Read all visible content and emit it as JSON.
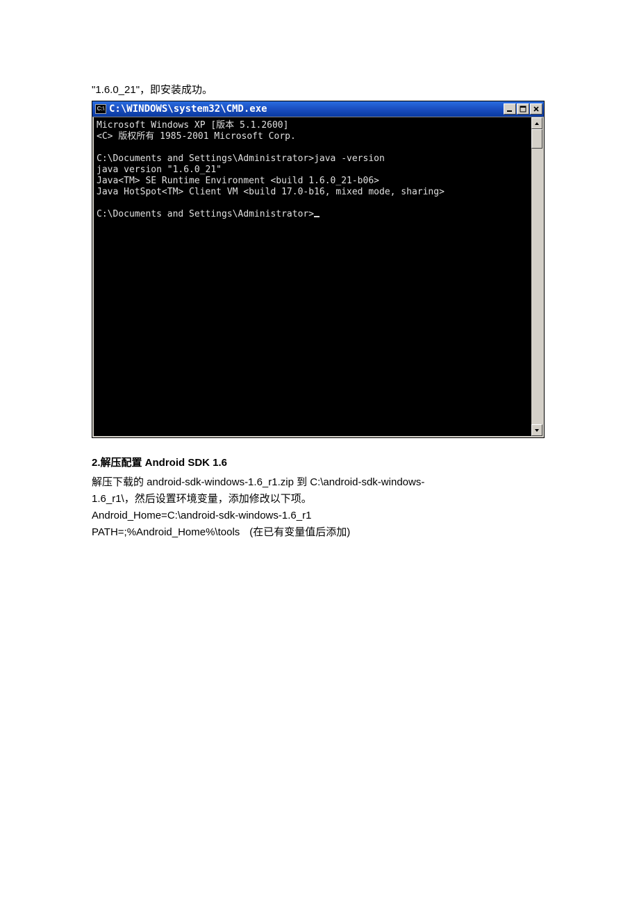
{
  "intro": "\"1.6.0_21\"，即安装成功。",
  "cmd": {
    "icon_label": "C:\\",
    "title": "C:\\WINDOWS\\system32\\CMD.exe",
    "lines": {
      "l0": "Microsoft Windows XP [版本 5.1.2600]",
      "l1": "<C> 版权所有 1985-2001 Microsoft Corp.",
      "l2": "",
      "l3": "C:\\Documents and Settings\\Administrator>java -version",
      "l4": "java version \"1.6.0_21\"",
      "l5": "Java<TM> SE Runtime Environment <build 1.6.0_21-b06>",
      "l6": "Java HotSpot<TM> Client VM <build 17.0-b16, mixed mode, sharing>",
      "l7": "",
      "l8": "C:\\Documents and Settings\\Administrator>"
    }
  },
  "section": {
    "heading": "2.解压配置 Android SDK 1.6",
    "p1a": "解压下载的 android-sdk-windows-1.6_r1.zip 到 C:\\android-sdk-windows-",
    "p1b": "1.6_r1\\，然后设置环境变量，添加修改以下项。",
    "p2": "Android_Home=C:\\android-sdk-windows-1.6_r1",
    "p3": "PATH=;%Android_Home%\\tools",
    "p3_note": "(在已有变量值后添加)"
  }
}
